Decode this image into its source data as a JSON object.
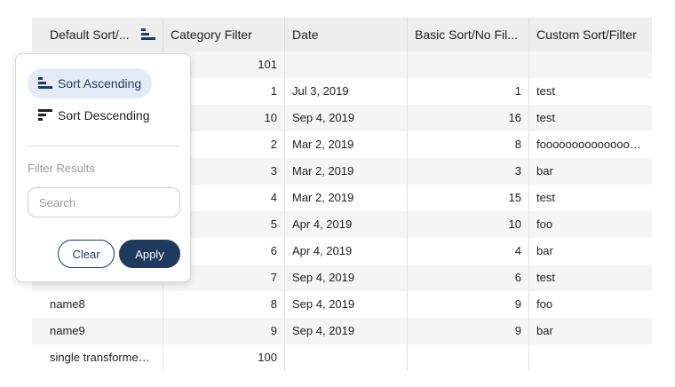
{
  "table": {
    "columns": [
      "Default Sort/...",
      "Category Filter",
      "Date",
      "Basic Sort/No Fil...",
      "Custom Sort/Filter"
    ],
    "rows": [
      {
        "name": "",
        "category": "101",
        "date": "",
        "basic": "",
        "custom": ""
      },
      {
        "name": "",
        "category": "1",
        "date": "Jul 3, 2019",
        "basic": "1",
        "custom": "test"
      },
      {
        "name": "",
        "category": "10",
        "date": "Sep 4, 2019",
        "basic": "16",
        "custom": "test"
      },
      {
        "name": "",
        "category": "2",
        "date": "Mar 2, 2019",
        "basic": "8",
        "custom": "fooooooooooooooo..."
      },
      {
        "name": "",
        "category": "3",
        "date": "Mar 2, 2019",
        "basic": "3",
        "custom": "bar"
      },
      {
        "name": "",
        "category": "4",
        "date": "Mar 2, 2019",
        "basic": "15",
        "custom": "test"
      },
      {
        "name": "",
        "category": "5",
        "date": "Apr 4, 2019",
        "basic": "10",
        "custom": "foo"
      },
      {
        "name": "",
        "category": "6",
        "date": "Apr 4, 2019",
        "basic": "4",
        "custom": "bar"
      },
      {
        "name": "",
        "category": "7",
        "date": "Sep 4, 2019",
        "basic": "6",
        "custom": "test"
      },
      {
        "name": "name8",
        "category": "8",
        "date": "Sep 4, 2019",
        "basic": "9",
        "custom": "foo"
      },
      {
        "name": "name9",
        "category": "9",
        "date": "Sep 4, 2019",
        "basic": "9",
        "custom": "bar"
      },
      {
        "name": "single transformed col",
        "category": "100",
        "date": "",
        "basic": "",
        "custom": ""
      }
    ]
  },
  "popover": {
    "sort_ascending": "Sort Ascending",
    "sort_descending": "Sort Descending",
    "filter_label": "Filter Results",
    "search_placeholder": "Search",
    "clear_label": "Clear",
    "apply_label": "Apply"
  },
  "colors": {
    "primary": "#1e3a5f",
    "active_bg": "#e3ecf6",
    "header_bg": "#eeeeee"
  },
  "icons": {
    "sort": "sort-bars-icon"
  }
}
